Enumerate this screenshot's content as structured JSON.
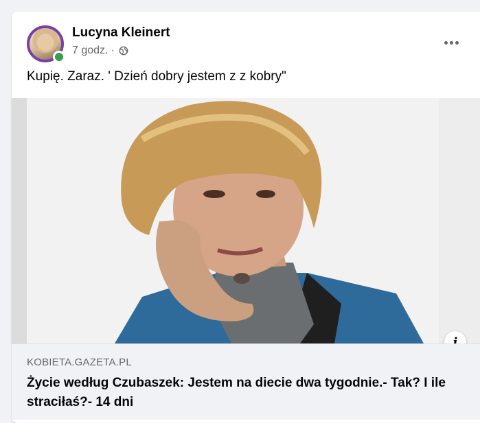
{
  "post": {
    "author": "Lucyna Kleinert",
    "time": "7 godz.",
    "separator": "·",
    "privacy_icon": "globe-icon",
    "text": "Kupię. Zaraz. ' Dzień dobry jestem z z kobry\"",
    "online": true
  },
  "link_preview": {
    "domain": "KOBIETA.GAZETA.PL",
    "title": "Życie według Czubaszek: Jestem na diecie dwa tygodnie.- Tak? I ile straciłaś?- 14 dni",
    "info_label": "i"
  },
  "colors": {
    "accent_online": "#31a24c",
    "avatar_ring": "#7a3fa5",
    "secondary_text": "#65676b"
  }
}
